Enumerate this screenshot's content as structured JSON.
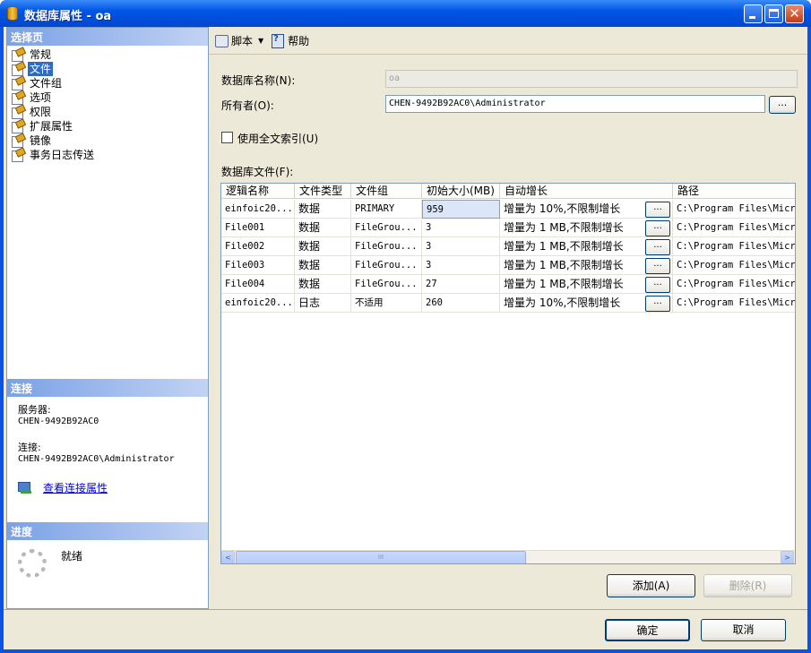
{
  "window": {
    "title": "数据库属性 - oa",
    "min_label": "",
    "max_label": "",
    "close_label": "✕"
  },
  "sidebar": {
    "select_page_header": "选择页",
    "pages": [
      {
        "label": "常规",
        "selected": false
      },
      {
        "label": "文件",
        "selected": true
      },
      {
        "label": "文件组",
        "selected": false
      },
      {
        "label": "选项",
        "selected": false
      },
      {
        "label": "权限",
        "selected": false
      },
      {
        "label": "扩展属性",
        "selected": false
      },
      {
        "label": "镜像",
        "selected": false
      },
      {
        "label": "事务日志传送",
        "selected": false
      }
    ],
    "connection_header": "连接",
    "server_label": "服务器:",
    "server_value": "CHEN-9492B92AC0",
    "connection_label": "连接:",
    "connection_value": "CHEN-9492B92AC0\\Administrator",
    "view_connection_link": "查看连接属性",
    "progress_header": "进度",
    "progress_status": "就绪"
  },
  "toolbar": {
    "script_label": "脚本",
    "help_label": "帮助"
  },
  "form": {
    "db_name_label": "数据库名称(N):",
    "db_name_value": "oa",
    "owner_label": "所有者(O):",
    "owner_value": "CHEN-9492B92AC0\\Administrator",
    "browse_label": "...",
    "fulltext_label": "使用全文索引(U)",
    "fulltext_checked": false,
    "db_files_label": "数据库文件(F):"
  },
  "grid": {
    "columns": [
      "逻辑名称",
      "文件类型",
      "文件组",
      "初始大小(MB)",
      "自动增长",
      "路径"
    ],
    "rows": [
      {
        "name": "einfoic20...",
        "type": "数据",
        "group": "PRIMARY",
        "size": "959",
        "growth": "增量为 10%,不限制增长",
        "path": "C:\\Program Files\\Micro",
        "selected_size": true
      },
      {
        "name": "File001",
        "type": "数据",
        "group": "FileGrou...",
        "size": "3",
        "growth": "增量为 1 MB,不限制增长",
        "path": "C:\\Program Files\\Micro"
      },
      {
        "name": "File002",
        "type": "数据",
        "group": "FileGrou...",
        "size": "3",
        "growth": "增量为 1 MB,不限制增长",
        "path": "C:\\Program Files\\Micro"
      },
      {
        "name": "File003",
        "type": "数据",
        "group": "FileGrou...",
        "size": "3",
        "growth": "增量为 1 MB,不限制增长",
        "path": "C:\\Program Files\\Micro"
      },
      {
        "name": "File004",
        "type": "数据",
        "group": "FileGrou...",
        "size": "27",
        "growth": "增量为 1 MB,不限制增长",
        "path": "C:\\Program Files\\Micro"
      },
      {
        "name": "einfoic20...",
        "type": "日志",
        "group": "不适用",
        "size": "260",
        "growth": "增量为 10%,不限制增长",
        "path": "C:\\Program Files\\Micro"
      }
    ],
    "cell_button_label": "...",
    "scroll_left": "<",
    "scroll_right": ">",
    "scroll_thumb": "III"
  },
  "buttons": {
    "add_label": "添加(A)",
    "remove_label": "删除(R)",
    "ok_label": "确定",
    "cancel_label": "取消"
  }
}
